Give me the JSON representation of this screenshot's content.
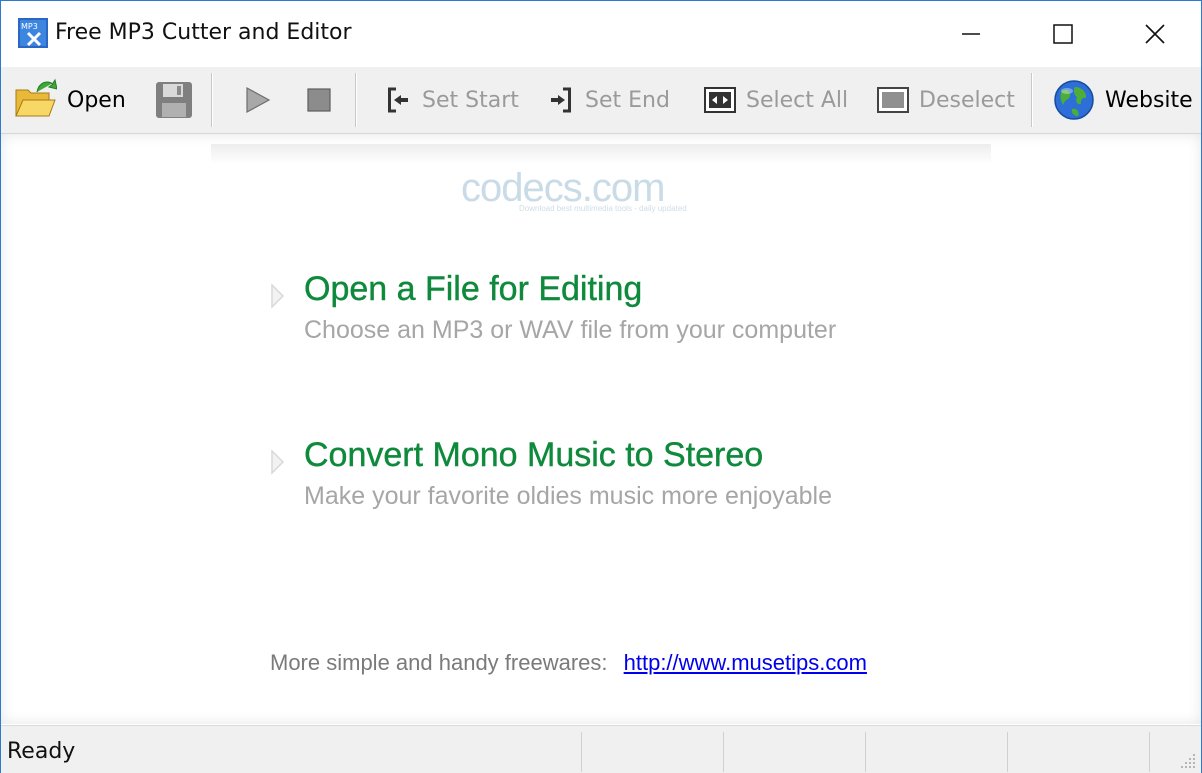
{
  "window": {
    "title": "Free MP3 Cutter and Editor",
    "app_icon": "mp3-cut-app-icon"
  },
  "toolbar": {
    "open_label": "Open",
    "set_start_label": "Set Start",
    "set_end_label": "Set End",
    "select_all_label": "Select All",
    "deselect_label": "Deselect",
    "website_label": "Website"
  },
  "content": {
    "watermark": "codecs.com",
    "watermark_sub": "Download best multimedia tools - daily updated",
    "actions": [
      {
        "title": "Open a File for Editing",
        "subtitle": "Choose an MP3 or WAV file from your computer"
      },
      {
        "title": "Convert Mono Music to Stereo",
        "subtitle": "Make your favorite oldies music more enjoyable"
      }
    ],
    "more_text": "More simple and handy freewares:",
    "more_link": "http://www.musetips.com"
  },
  "status": {
    "text": "Ready"
  },
  "colors": {
    "accent_green": "#0f8a3c",
    "link_blue": "#0000ee",
    "window_border": "#2d7ad1"
  }
}
